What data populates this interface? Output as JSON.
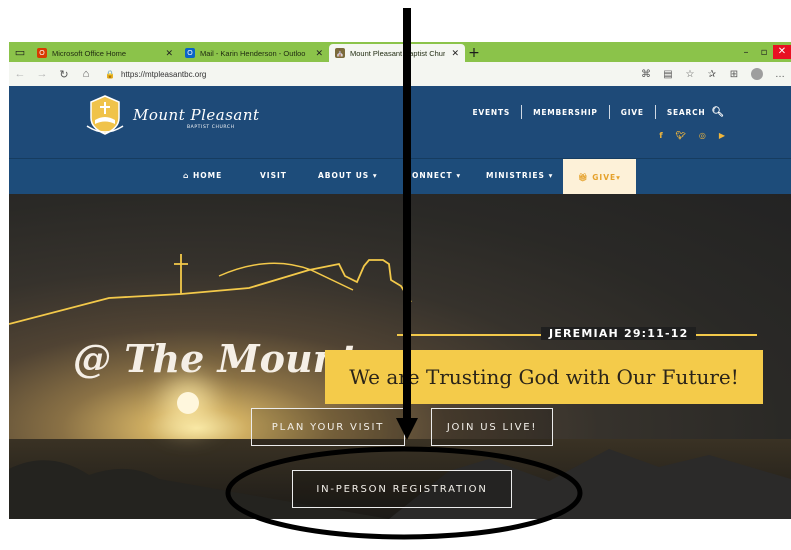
{
  "browser": {
    "tabs": [
      {
        "label": "Microsoft Office Home",
        "icon": "office-icon",
        "icon_color": "#d83b01"
      },
      {
        "label": "Mail - Karin Henderson - Outloo",
        "icon": "outlook-icon",
        "icon_color": "#0a64c8"
      },
      {
        "label": "Mount Pleasant Baptist Church",
        "icon": "church-favicon-icon",
        "icon_color": "#7a6a3a"
      }
    ],
    "url": "https://mtpleasantbc.org"
  },
  "header": {
    "logo_name": "Mount Pleasant",
    "logo_sub": "BAPTIST CHURCH",
    "top_links": [
      "EVENTS",
      "MEMBERSHIP",
      "GIVE",
      "SEARCH"
    ],
    "social_icons": [
      "facebook-icon",
      "twitter-icon",
      "instagram-icon",
      "youtube-icon"
    ]
  },
  "nav": {
    "home": "HOME",
    "visit": "VISIT",
    "about": "ABOUT US",
    "connect": "ONNECT",
    "ministries": "MINISTRIES",
    "give": "GIVE"
  },
  "hero": {
    "title": "@ The Mount",
    "scripture": "JEREMIAH 29:11-12",
    "banner": "We are Trusting God with Our Future!",
    "buttons": {
      "plan": "PLAN YOUR VISIT",
      "join": "JOIN US LIVE!",
      "registration": "IN-PERSON REGISTRATION"
    }
  },
  "colors": {
    "header_blue": "#1e4a78",
    "accent_gold": "#f4cb4a",
    "browser_green": "#8bc34a"
  }
}
